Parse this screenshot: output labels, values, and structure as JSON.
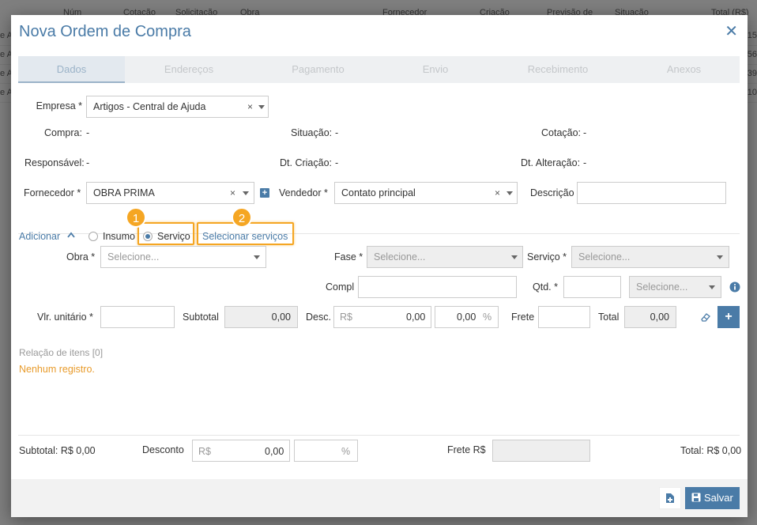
{
  "background": {
    "headers": [
      "Núm",
      "Cotação",
      "Solicitação",
      "Obra",
      "Fornecedor",
      "Criação",
      "Previsão de",
      "Situação",
      "Total (R$)"
    ],
    "rows": [
      {
        "left": "e A",
        "right": "15"
      },
      {
        "left": "e A",
        "right": "56"
      },
      {
        "left": "e A",
        "right": "39"
      },
      {
        "left": "e A",
        "right": "10"
      }
    ]
  },
  "modal": {
    "title": "Nova Ordem de Compra",
    "close_glyph": "✕",
    "tabs": [
      "Dados",
      "Endereços",
      "Pagamento",
      "Envio",
      "Recebimento",
      "Anexos"
    ],
    "active_tab": "Dados"
  },
  "form": {
    "empresa_label": "Empresa *",
    "empresa_value": "Artigos - Central de Ajuda",
    "compra_label": "Compra:",
    "compra_value": "-",
    "situacao_label": "Situação:",
    "situacao_value": "-",
    "cotacao_label": "Cotação:",
    "cotacao_value": "-",
    "responsavel_label": "Responsável:",
    "responsavel_value": "-",
    "dt_criacao_label": "Dt. Criação:",
    "dt_criacao_value": "-",
    "dt_alteracao_label": "Dt. Alteração:",
    "dt_alteracao_value": "-",
    "fornecedor_label": "Fornecedor *",
    "fornecedor_value": "OBRA PRIMA",
    "vendedor_label": "Vendedor *",
    "vendedor_value": "Contato principal",
    "descricao_label": "Descrição",
    "descricao_value": "",
    "clear_glyph": "×"
  },
  "adicionar": {
    "label": "Adicionar",
    "option_insumo": "Insumo",
    "option_servico": "Serviço",
    "selected": "Serviço",
    "selecionar_servicos": "Selecionar serviços",
    "badge_1": "1",
    "badge_2": "2"
  },
  "item": {
    "obra_label": "Obra *",
    "obra_placeholder": "Selecione...",
    "fase_label": "Fase *",
    "fase_placeholder": "Selecione...",
    "servico_label": "Serviço *",
    "servico_placeholder": "Selecione...",
    "compl_label": "Compl",
    "qtd_label": "Qtd. *",
    "unidade_placeholder": "Selecione...",
    "vlr_unitario_label": "Vlr. unitário *",
    "subtotal_label": "Subtotal",
    "subtotal_value": "0,00",
    "desc_label": "Desc.",
    "desc_prefix": "R$",
    "desc_value": "0,00",
    "desc_percent_value": "0,00",
    "percent_sign": "%",
    "frete_label": "Frete",
    "total_label": "Total",
    "total_value": "0,00"
  },
  "relacao": {
    "label": "Relação de itens [0]",
    "empty": "Nenhum registro."
  },
  "totals": {
    "subtotal": "Subtotal: R$ 0,00",
    "desconto_label": "Desconto",
    "desconto_prefix": "R$",
    "desconto_value": "0,00",
    "percent_sign": "%",
    "frete_label": "Frete R$",
    "total": "Total: R$ 0,00"
  },
  "footer": {
    "save_label": "Salvar"
  },
  "colors": {
    "accent": "#4a7ba7",
    "highlight": "#f5a623",
    "empty_text": "#e89b2b"
  }
}
